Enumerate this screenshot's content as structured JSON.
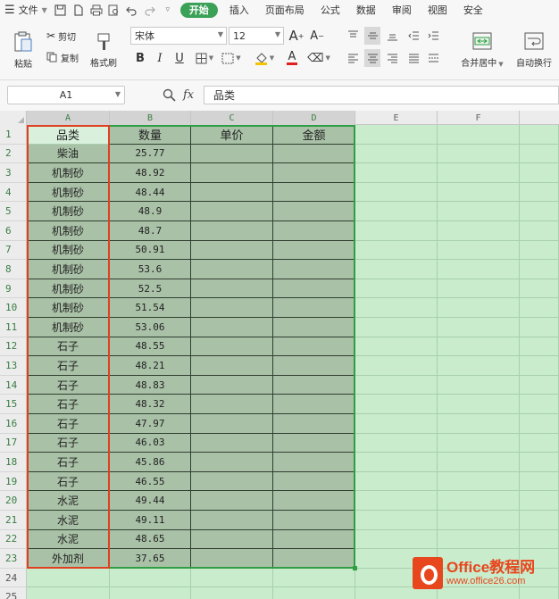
{
  "menubar": {
    "file_label": "文件",
    "tabs": [
      "开始",
      "插入",
      "页面布局",
      "公式",
      "数据",
      "审阅",
      "视图",
      "安全"
    ],
    "active_tab": "开始"
  },
  "ribbon": {
    "paste_label": "粘贴",
    "cut_label": "剪切",
    "copy_label": "复制",
    "format_painter_label": "格式刷",
    "font_name": "宋体",
    "font_size": "12",
    "merge_center_label": "合并居中",
    "wrap_text_label": "自动换行",
    "bold_glyph": "B",
    "italic_glyph": "I",
    "underline_glyph": "U",
    "font_color_glyph": "A"
  },
  "formula_bar": {
    "name_box": "A1",
    "fx_label": "fx",
    "content": "品类"
  },
  "sheet": {
    "columns": [
      "A",
      "B",
      "C",
      "D",
      "E",
      "F"
    ],
    "header_row": [
      "品类",
      "数量",
      "单价",
      "金额"
    ],
    "rows": [
      [
        "柴油",
        "25.77"
      ],
      [
        "机制砂",
        "48.92"
      ],
      [
        "机制砂",
        "48.44"
      ],
      [
        "机制砂",
        "48.9"
      ],
      [
        "机制砂",
        "48.7"
      ],
      [
        "机制砂",
        "50.91"
      ],
      [
        "机制砂",
        "53.6"
      ],
      [
        "机制砂",
        "52.5"
      ],
      [
        "机制砂",
        "51.54"
      ],
      [
        "机制砂",
        "53.06"
      ],
      [
        "石子",
        "48.55"
      ],
      [
        "石子",
        "48.21"
      ],
      [
        "石子",
        "48.83"
      ],
      [
        "石子",
        "48.32"
      ],
      [
        "石子",
        "47.97"
      ],
      [
        "石子",
        "46.03"
      ],
      [
        "石子",
        "45.86"
      ],
      [
        "石子",
        "46.55"
      ],
      [
        "水泥",
        "49.44"
      ],
      [
        "水泥",
        "49.11"
      ],
      [
        "水泥",
        "48.65"
      ],
      [
        "外加剂",
        "37.65"
      ]
    ],
    "row_numbers": [
      "1",
      "2",
      "3",
      "4",
      "5",
      "6",
      "7",
      "8",
      "9",
      "10",
      "11",
      "12",
      "13",
      "14",
      "15",
      "16",
      "17",
      "18",
      "19",
      "20",
      "21",
      "22",
      "23",
      "24",
      "25"
    ]
  },
  "watermark": {
    "brand": "Office教程网",
    "url": "www.office26.com"
  },
  "colors": {
    "accent_green": "#3aa157",
    "sheet_bg": "#c8eccc",
    "selected_fill": "#a9c1a7",
    "red_border": "#e0401f",
    "green_border": "#2f9e45"
  }
}
